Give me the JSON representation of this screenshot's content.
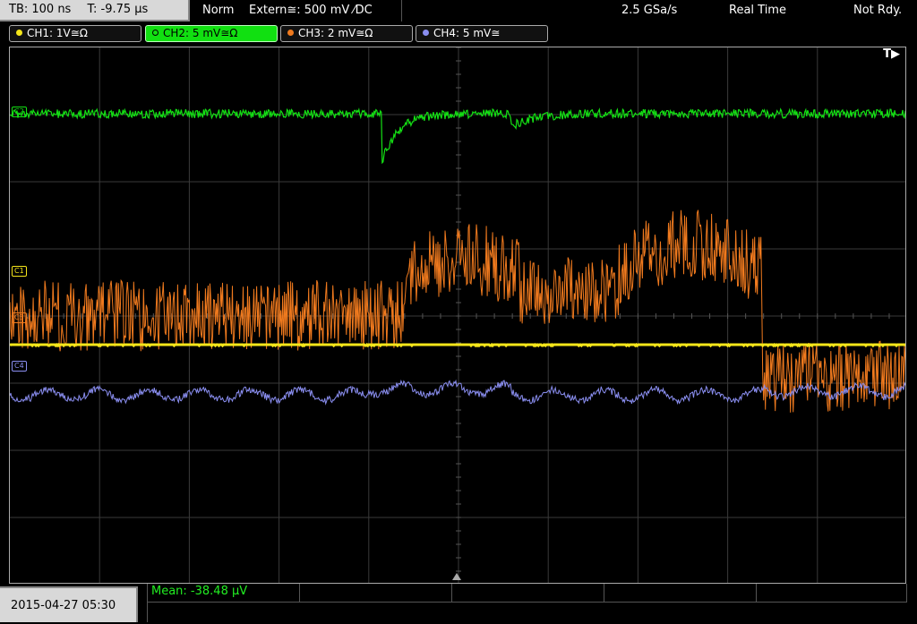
{
  "header": {
    "timebase": "TB: 100 ns",
    "trigger_time": "T: -9.75 µs",
    "trigger_mode": "Norm",
    "trigger_source": "Extern≅: 500 mV ⁄DC",
    "sample_rate": "2.5 GSa/s",
    "acquisition": "Real Time",
    "status": "Not Rdy."
  },
  "channels": [
    {
      "label": "CH1: 1V≅Ω",
      "color": "#f5e61a",
      "active": false,
      "marker": "C1"
    },
    {
      "label": "CH2: 5 mV≅Ω",
      "color": "#14e014",
      "active": true,
      "marker": "C2"
    },
    {
      "label": "CH3: 2 mV≅Ω",
      "color": "#f07a1e",
      "active": false,
      "marker": "C3"
    },
    {
      "label": "CH4: 5 mV≅",
      "color": "#8a8ef0",
      "active": false,
      "marker": "C4"
    }
  ],
  "trigger_marker": "T▶",
  "measurement": {
    "label": "Mean: -38.48 µV"
  },
  "footer": {
    "datetime": "2015-04-27 05:30"
  },
  "grid_color": "#3a3a3a"
}
